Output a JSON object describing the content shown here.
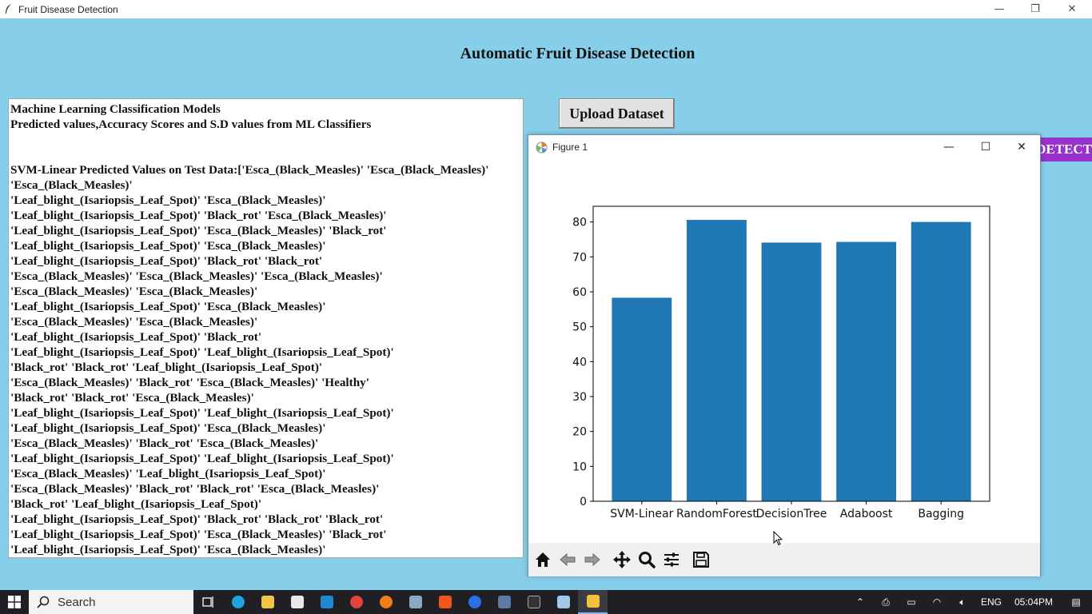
{
  "window": {
    "title": "Fruit Disease Detection",
    "minimize": "—",
    "restore": "❐",
    "close": "✕"
  },
  "app": {
    "heading": "Automatic Fruit Disease Detection",
    "upload_label": "Upload Dataset",
    "detect_label": "DETECT"
  },
  "output_text": [
    "Machine Learning Classification Models",
    "Predicted values,Accuracy Scores and S.D values from ML Classifiers",
    "",
    "",
    "SVM-Linear Predicted Values on Test Data:['Esca_(Black_Measles)' 'Esca_(Black_Measles)'",
    "'Esca_(Black_Measles)'",
    " 'Leaf_blight_(Isariopsis_Leaf_Spot)' 'Esca_(Black_Measles)'",
    " 'Leaf_blight_(Isariopsis_Leaf_Spot)' 'Black_rot' 'Esca_(Black_Measles)'",
    " 'Leaf_blight_(Isariopsis_Leaf_Spot)' 'Esca_(Black_Measles)' 'Black_rot'",
    " 'Leaf_blight_(Isariopsis_Leaf_Spot)' 'Esca_(Black_Measles)'",
    " 'Leaf_blight_(Isariopsis_Leaf_Spot)' 'Black_rot' 'Black_rot'",
    " 'Esca_(Black_Measles)' 'Esca_(Black_Measles)' 'Esca_(Black_Measles)'",
    " 'Esca_(Black_Measles)' 'Esca_(Black_Measles)'",
    " 'Leaf_blight_(Isariopsis_Leaf_Spot)' 'Esca_(Black_Measles)'",
    " 'Esca_(Black_Measles)' 'Esca_(Black_Measles)'",
    " 'Leaf_blight_(Isariopsis_Leaf_Spot)' 'Black_rot'",
    " 'Leaf_blight_(Isariopsis_Leaf_Spot)' 'Leaf_blight_(Isariopsis_Leaf_Spot)'",
    " 'Black_rot' 'Black_rot' 'Leaf_blight_(Isariopsis_Leaf_Spot)'",
    " 'Esca_(Black_Measles)' 'Black_rot' 'Esca_(Black_Measles)' 'Healthy'",
    " 'Black_rot' 'Black_rot' 'Esca_(Black_Measles)'",
    " 'Leaf_blight_(Isariopsis_Leaf_Spot)' 'Leaf_blight_(Isariopsis_Leaf_Spot)'",
    " 'Leaf_blight_(Isariopsis_Leaf_Spot)' 'Esca_(Black_Measles)'",
    " 'Esca_(Black_Measles)' 'Black_rot' 'Esca_(Black_Measles)'",
    " 'Leaf_blight_(Isariopsis_Leaf_Spot)' 'Leaf_blight_(Isariopsis_Leaf_Spot)'",
    " 'Esca_(Black_Measles)' 'Leaf_blight_(Isariopsis_Leaf_Spot)'",
    " 'Esca_(Black_Measles)' 'Black_rot' 'Black_rot' 'Esca_(Black_Measles)'",
    " 'Black_rot' 'Leaf_blight_(Isariopsis_Leaf_Spot)'",
    " 'Leaf_blight_(Isariopsis_Leaf_Spot)' 'Black_rot' 'Black_rot' 'Black_rot'",
    " 'Leaf_blight_(Isariopsis_Leaf_Spot)' 'Esca_(Black_Measles)' 'Black_rot'",
    " 'Leaf_blight_(Isariopsis_Leaf_Spot)' 'Esca_(Black_Measles)'"
  ],
  "figure": {
    "title": "Figure 1",
    "minimize": "—",
    "maximize": "☐",
    "close": "✕"
  },
  "chart_data": {
    "type": "bar",
    "categories": [
      "SVM-Linear",
      "RandomForest",
      "DecisionTree",
      "Adaboost",
      "Bagging"
    ],
    "values": [
      58.3,
      80.6,
      74.1,
      74.3,
      80.0
    ],
    "title": "",
    "xlabel": "",
    "ylabel": "",
    "ylim": [
      0,
      84.5
    ],
    "yticks": [
      0,
      10,
      20,
      30,
      40,
      50,
      60,
      70,
      80
    ],
    "bar_color": "#1f77b4",
    "grid": false
  },
  "toolbar_icons": [
    "home-icon",
    "back-arrow-icon",
    "forward-arrow-icon",
    "pan-icon",
    "zoom-icon",
    "configure-icon",
    "save-icon"
  ],
  "taskbar": {
    "search_placeholder": "Search",
    "language": "ENG",
    "time": "05:04PM"
  }
}
